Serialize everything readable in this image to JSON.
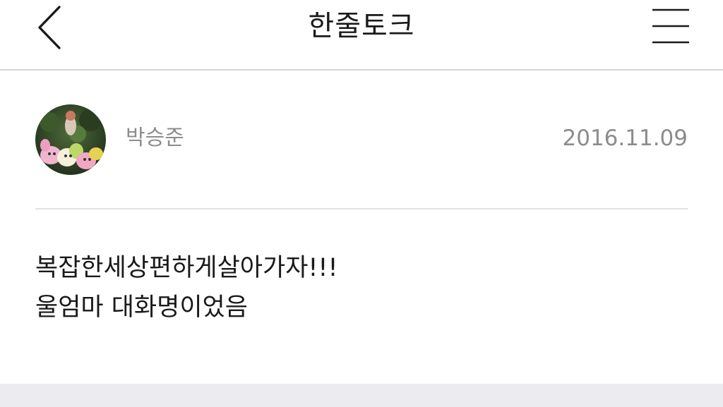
{
  "header": {
    "title": "한줄토크",
    "back_icon": "chevron-left-icon",
    "menu_icon": "hamburger-menu-icon"
  },
  "post": {
    "author_name": "박승준",
    "date": "2016.11.09",
    "lines": [
      "복잡한세상편하게살아가자!!!",
      "울엄마 대화명이었음"
    ]
  },
  "colors": {
    "text_primary": "#1a1a1a",
    "text_secondary": "#8c8c8c",
    "divider": "#e2e2e2",
    "footer_band": "#ececf0"
  }
}
